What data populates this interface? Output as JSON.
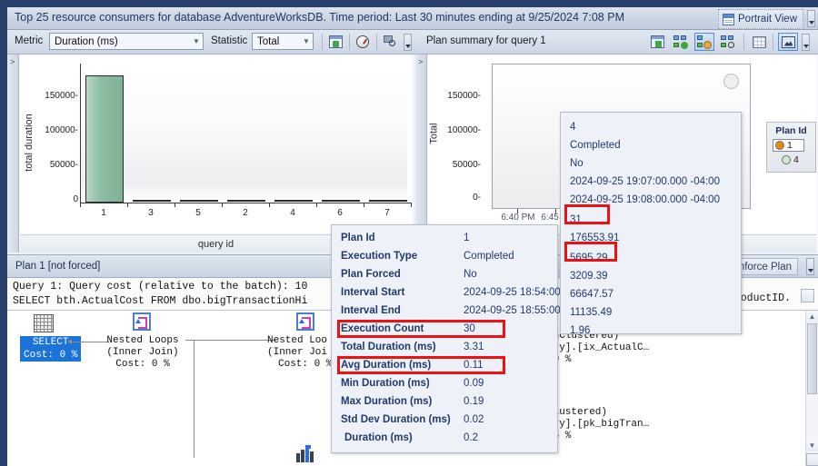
{
  "window": {
    "title": "Top 25 resource consumers for database AdventureWorksDB. Time period: Last 30 minutes ending at 9/25/2024 7:08 PM",
    "portrait_view_label": "Portrait View"
  },
  "toolbar_left": {
    "metric_label": "Metric",
    "metric_value": "Duration (ms)",
    "statistic_label": "Statistic",
    "statistic_value": "Total",
    "buttons": [
      {
        "name": "configure-icon",
        "tip": "Configure"
      },
      {
        "name": "gauge-icon",
        "tip": "Metric gauge"
      },
      {
        "name": "zoom-query-icon",
        "tip": "View query text"
      }
    ]
  },
  "toolbar_right": {
    "title": "Plan summary for query 1",
    "buttons": [
      {
        "name": "configure-icon"
      },
      {
        "name": "force-plan-icon"
      },
      {
        "name": "unforce-plan-icon"
      },
      {
        "name": "compare-plan-icon"
      },
      {
        "name": "grid-view-icon"
      },
      {
        "name": "chart-view-icon"
      }
    ]
  },
  "left_chart": {
    "ylabel": "total duration",
    "xlabel": "query id",
    "yticks": [
      "150000-",
      "100000-",
      "50000-",
      "0"
    ],
    "ytick_values": [
      150000,
      100000,
      50000,
      0
    ],
    "categories": [
      "1",
      "3",
      "5",
      "2",
      "4",
      "6",
      "7"
    ],
    "values": [
      176554,
      0,
      0,
      0,
      0,
      0,
      0
    ],
    "bar_color": "#8dbda2"
  },
  "right_chart": {
    "ylabel": "Total",
    "yticks": [
      "150000-",
      "100000-",
      "50000-",
      "0-"
    ],
    "ytick_values": [
      150000,
      100000,
      50000,
      0
    ],
    "xticks": [
      "6:40 PM",
      "6:45 PM"
    ],
    "caption": "1",
    "legend": {
      "title": "Plan Id",
      "items": [
        {
          "label": "1",
          "color": "#e8880f",
          "selected": true
        },
        {
          "label": "4",
          "color": "#bfe0c2",
          "selected": false
        }
      ]
    }
  },
  "chart_data": [
    {
      "type": "bar",
      "title": "Top 25 resource consumers",
      "xlabel": "query id",
      "ylabel": "total duration",
      "categories": [
        "1",
        "3",
        "5",
        "2",
        "4",
        "6",
        "7"
      ],
      "values": [
        176554,
        0,
        0,
        0,
        0,
        0,
        0
      ],
      "ylim": [
        0,
        180000
      ],
      "yticks": [
        0,
        50000,
        100000,
        150000
      ],
      "grid": false,
      "legend": "none"
    },
    {
      "type": "bar",
      "title": "Plan summary for query 1",
      "xlabel": "",
      "ylabel": "Total",
      "categories": [
        "6:40 PM",
        "6:45 PM"
      ],
      "series": [
        {
          "name": "Plan Id 1",
          "values": [
            0,
            0
          ],
          "color": "#e8880f"
        },
        {
          "name": "Plan Id 4",
          "values": [
            0,
            0
          ],
          "color": "#bfe0c2"
        }
      ],
      "ylim": [
        0,
        180000
      ],
      "yticks": [
        0,
        50000,
        100000,
        150000
      ],
      "grid": false,
      "legend": "right"
    }
  ],
  "plan_header": {
    "title": "Plan 1 [not forced]",
    "unforce_label": "Unforce Plan"
  },
  "query_text": {
    "line1": "Query 1: Query cost (relative to the batch): 10",
    "line2": "SELECT bth.ActualCost FROM dbo.bigTransactionHi",
    "line2_right": "roductID."
  },
  "plan_nodes": [
    {
      "label_line1": "SELECT",
      "label_line2": "Cost: 0 %",
      "type": "select"
    },
    {
      "label_line1": "Nested Loops",
      "label_line2": "(Inner Join)",
      "label_line3": "Cost: 0 %",
      "type": "nested-loops"
    },
    {
      "label_line1": "Nested Loo",
      "label_line2": "(Inner Joi",
      "label_line3": "Cost: 0 %",
      "type": "nested-loops"
    }
  ],
  "plan_right_text": [
    "onClustered)",
    "ory].[ix_ActualC…",
    "30 %",
    "]",
    "Clustered)",
    "ory].[pk_bigTran…",
    "35 %"
  ],
  "tooltip_detail": {
    "rows": [
      {
        "key": "Plan Id",
        "value": "1",
        "highlight": false
      },
      {
        "key": "Execution Type",
        "value": "Completed",
        "highlight": false
      },
      {
        "key": "Plan Forced",
        "value": "No",
        "highlight": false
      },
      {
        "key": "Interval Start",
        "value": "2024-09-25 18:54:00.0",
        "highlight": false
      },
      {
        "key": "Interval End",
        "value": "2024-09-25 18:55:00.0",
        "highlight": false
      },
      {
        "key": "Execution Count",
        "value": "30",
        "highlight": true
      },
      {
        "key": "Total Duration (ms)",
        "value": "3.31",
        "highlight": false
      },
      {
        "key": "Avg Duration (ms)",
        "value": "0.11",
        "highlight": true
      },
      {
        "key": "Min Duration (ms)",
        "value": "0.09",
        "highlight": false
      },
      {
        "key": "Max Duration (ms)",
        "value": "0.19",
        "highlight": false
      },
      {
        "key": "Std Dev Duration (ms)",
        "value": "0.02",
        "highlight": false
      },
      {
        "key": "Duration (ms)",
        "value": "0.2",
        "highlight": false
      }
    ]
  },
  "tooltip_values": {
    "rows": [
      {
        "value": "4",
        "highlight": false
      },
      {
        "value": "Completed",
        "highlight": false
      },
      {
        "value": "No",
        "highlight": false
      },
      {
        "value": "2024-09-25 19:07:00.000 -04:00",
        "highlight": false
      },
      {
        "value": "2024-09-25 19:08:00.000 -04:00",
        "highlight": false
      },
      {
        "value": "31",
        "highlight": true
      },
      {
        "value": "176553.91",
        "highlight": false
      },
      {
        "value": "5695.29",
        "highlight": true
      },
      {
        "value": "3209.39",
        "highlight": false
      },
      {
        "value": "66647.57",
        "highlight": false
      },
      {
        "value": "11135.49",
        "highlight": false
      },
      {
        "value": "1.96",
        "highlight": false
      }
    ]
  },
  "colors": {
    "highlight_red": "#ee1111",
    "accent_blue": "#1f3a6e",
    "frame": "#27416b"
  }
}
